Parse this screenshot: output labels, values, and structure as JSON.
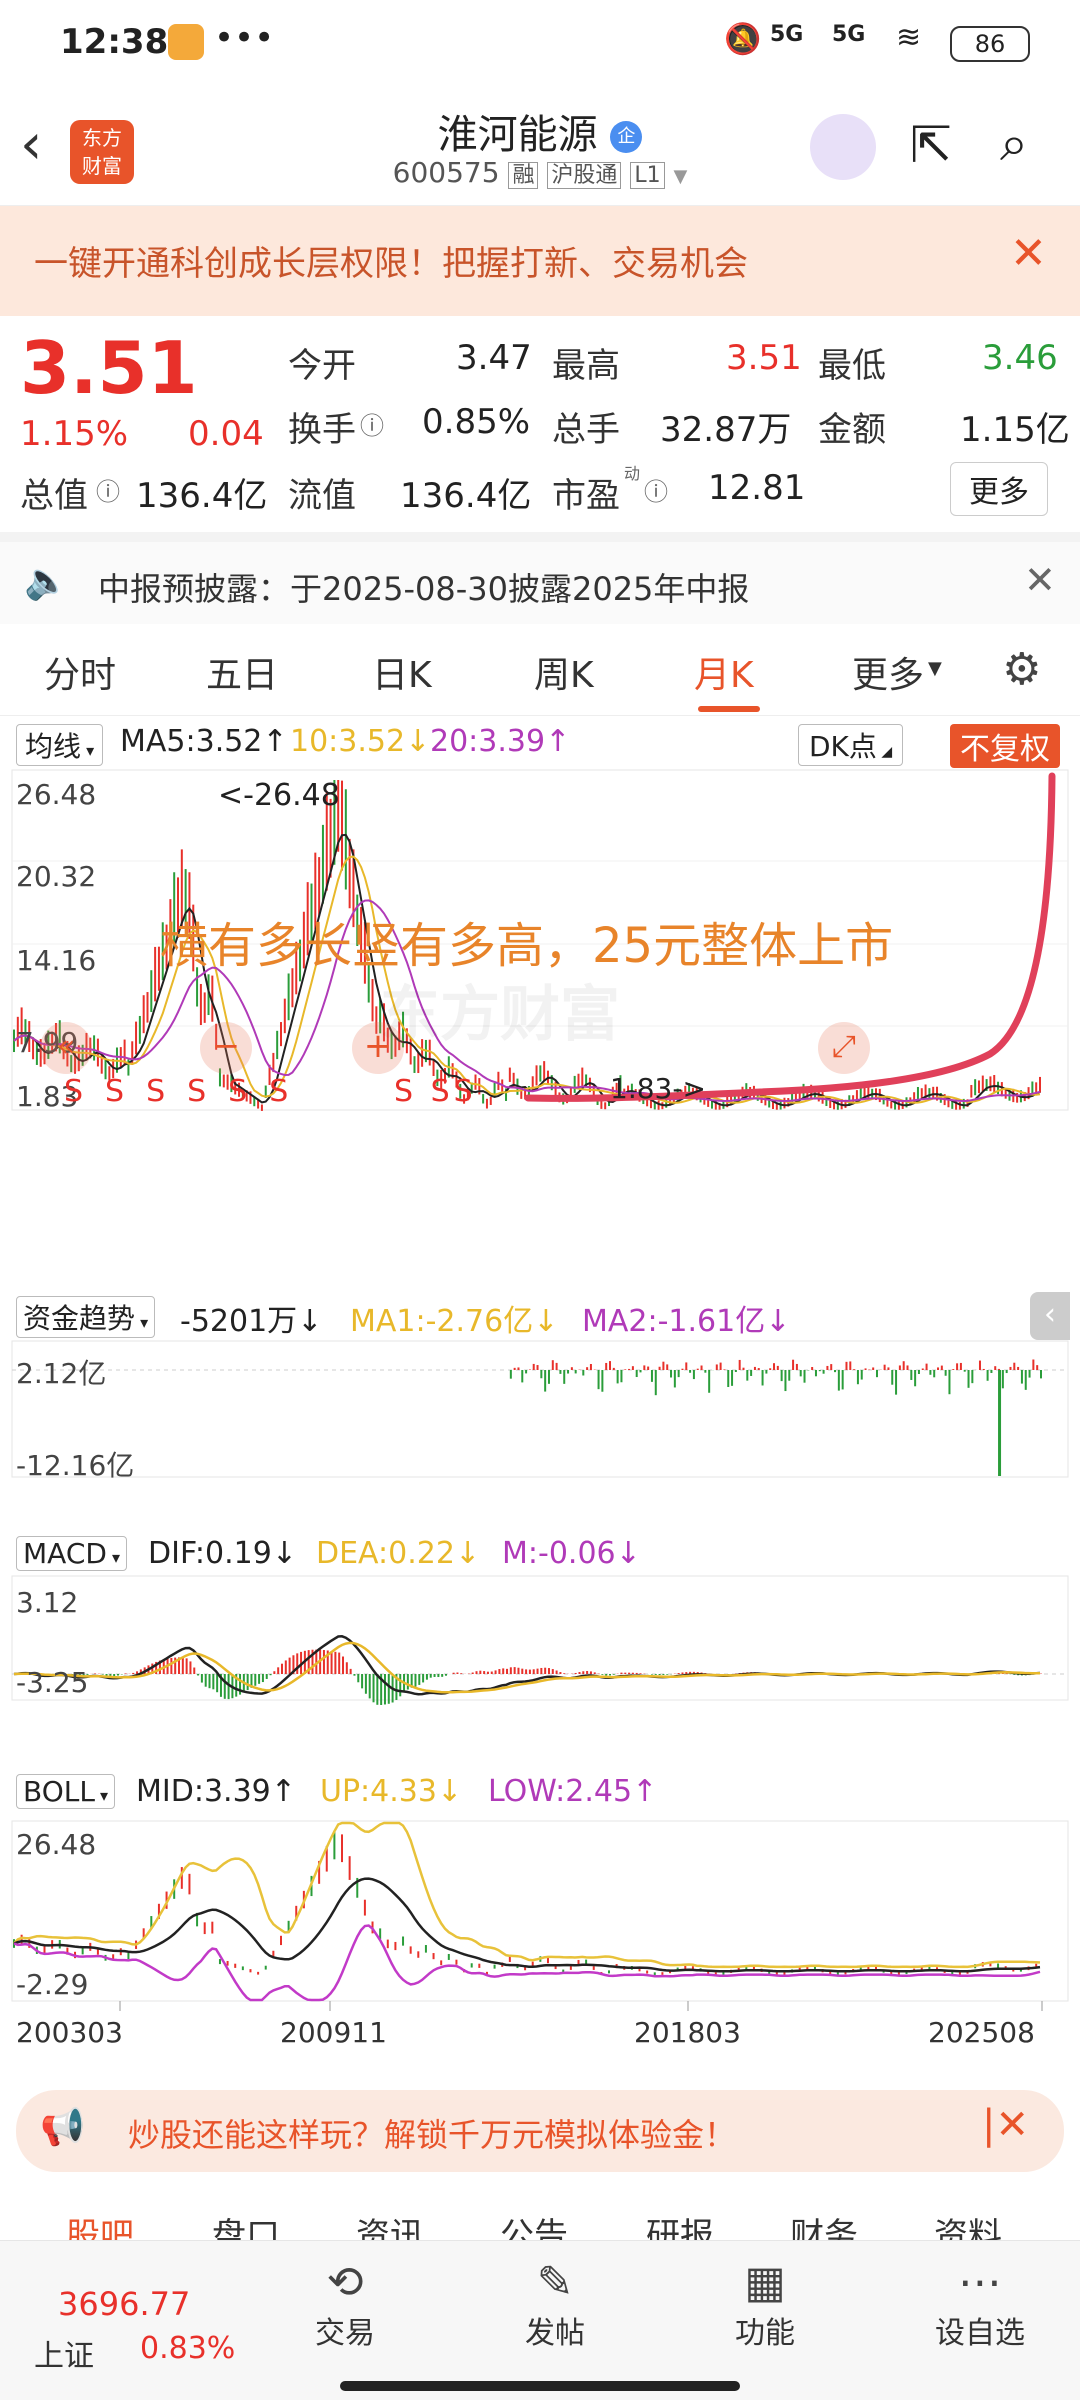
{
  "status": {
    "time": "12:38",
    "dots": "•••",
    "signal1": "5G",
    "signal2": "5G",
    "battery": "86"
  },
  "header": {
    "logo_line1": "东方",
    "logo_line2": "财富",
    "title": "淮河能源",
    "badge": "企",
    "code": "600575",
    "tags": [
      "融",
      "沪股通",
      "L1"
    ]
  },
  "banner": {
    "text": "一键开通科创成长层权限！把握打新、交易机会"
  },
  "quote": {
    "price": "3.51",
    "pct": "1.15%",
    "change": "0.04",
    "open_label": "今开",
    "open": "3.47",
    "high_label": "最高",
    "high": "3.51",
    "low_label": "最低",
    "low": "3.46",
    "turnover_label": "换手",
    "turnover": "0.85%",
    "volume_label": "总手",
    "volume": "32.87万",
    "amount_label": "金额",
    "amount": "1.15亿",
    "mktcap_label": "总值",
    "mktcap": "136.4亿",
    "float_label": "流值",
    "float": "136.4亿",
    "pe_label": "市盈",
    "pe_sup": "动",
    "pe": "12.81",
    "more": "更多"
  },
  "notice": {
    "text": "中报预披露：于2025-08-30披露2025年中报"
  },
  "tabs": [
    "分时",
    "五日",
    "日K",
    "周K",
    "月K",
    "更多"
  ],
  "active_tab": "月K",
  "chart": {
    "ma_select": "均线",
    "ma5": "MA5:3.52↑",
    "ma10": "10:3.52↓",
    "ma20": "20:3.39↑",
    "dk": "DK点",
    "fq": "不复权",
    "y_labels": [
      "26.48",
      "20.32",
      "14.16",
      "7.99",
      "1.83"
    ],
    "max_mark": "<-26.48",
    "min_mark": "1.83->",
    "annotation": "横有多长竖有多高，25元整体上市",
    "watermark": "东方财富",
    "fund_select": "资金趋势",
    "fund_val": "-5201万↓",
    "fund_ma1": "MA1:-2.76亿↓",
    "fund_ma2": "MA2:-1.61亿↓",
    "fund_y": [
      "2.12亿",
      "-12.16亿"
    ],
    "macd_select": "MACD",
    "dif": "DIF:0.19↓",
    "dea": "DEA:0.22↓",
    "m": "M:-0.06↓",
    "macd_y": [
      "3.12",
      "-3.25"
    ],
    "boll_select": "BOLL",
    "mid": "MID:3.39↑",
    "up": "UP:4.33↓",
    "low": "LOW:2.45↑",
    "boll_y": [
      "26.48",
      "-2.29"
    ],
    "x_labels": [
      "200303",
      "200911",
      "201803",
      "202508"
    ]
  },
  "ad": {
    "text": "炒股还能这样玩？解锁千万元模拟体验金！"
  },
  "bottom_tabs": [
    "股吧",
    "盘口",
    "资讯",
    "公告",
    "研报",
    "财务",
    "资料"
  ],
  "bottombar": {
    "index_val": "3696.77",
    "index_name": "上证",
    "index_pct": "0.83%",
    "items": [
      "交易",
      "发帖",
      "功能",
      "设自选"
    ]
  },
  "colors": {
    "red": "#e8302a",
    "green": "#2a9d3a",
    "orange": "#e8842a",
    "purple": "#b03ab8",
    "yellow": "#e8b82a"
  }
}
